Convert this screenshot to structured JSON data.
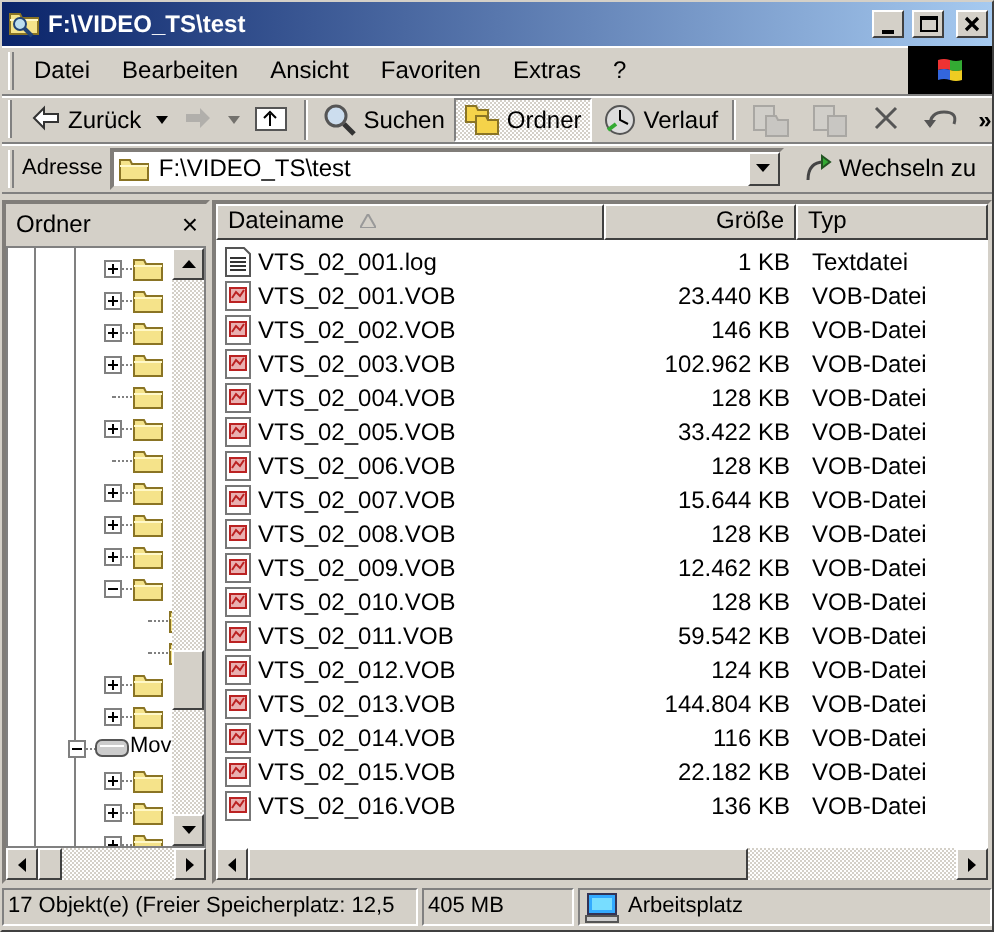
{
  "window": {
    "title": "F:\\VIDEO_TS\\test"
  },
  "menu": [
    {
      "label": "Datei"
    },
    {
      "label": "Bearbeiten"
    },
    {
      "label": "Ansicht"
    },
    {
      "label": "Favoriten"
    },
    {
      "label": "Extras"
    },
    {
      "label": "?"
    }
  ],
  "toolbar": {
    "buttons": [
      {
        "kind": "back",
        "label": "Zurück",
        "disabled": false
      },
      {
        "kind": "forward",
        "disabled": true
      },
      {
        "kind": "up",
        "disabled": false
      },
      {
        "kind": "search",
        "label": "Suchen",
        "selected": false
      },
      {
        "kind": "folders",
        "label": "Ordner",
        "selected": true
      },
      {
        "kind": "history",
        "label": "Verlauf",
        "selected": false
      },
      {
        "kind": "move",
        "disabled": true
      },
      {
        "kind": "copy",
        "disabled": true
      },
      {
        "kind": "delete",
        "disabled": false
      },
      {
        "kind": "undo",
        "disabled": false
      }
    ],
    "overflow": "»"
  },
  "address": {
    "label": "Adresse",
    "value": "F:\\VIDEO_TS\\test",
    "go": "Wechseln zu"
  },
  "tree": {
    "title": "Ordner",
    "close": "×",
    "items": [
      {
        "kind": "continuation",
        "children": [
          {
            "kind": "folder",
            "expanded": false
          },
          {
            "kind": "folder",
            "expanded": false
          },
          {
            "kind": "folder",
            "expanded": false
          },
          {
            "kind": "folder",
            "expanded": false
          },
          {
            "kind": "folder"
          },
          {
            "kind": "folder",
            "expanded": false
          },
          {
            "kind": "folder"
          },
          {
            "kind": "folder",
            "expanded": false
          },
          {
            "kind": "folder",
            "expanded": false
          },
          {
            "kind": "folder",
            "expanded": false
          },
          {
            "kind": "folder",
            "expanded": true,
            "children": [
              {
                "kind": "folder"
              },
              {
                "kind": "folder"
              }
            ]
          },
          {
            "kind": "folder",
            "expanded": false
          },
          {
            "kind": "folder",
            "expanded": false
          }
        ]
      },
      {
        "kind": "drive",
        "label": "Mov",
        "expanded": true,
        "children": [
          {
            "kind": "folder",
            "expanded": false
          },
          {
            "kind": "folder",
            "expanded": false
          },
          {
            "kind": "folder",
            "expanded": false
          }
        ]
      }
    ]
  },
  "files": {
    "columns": [
      {
        "label": "Dateiname",
        "sorted": true
      },
      {
        "label": "Größe"
      },
      {
        "label": "Typ"
      }
    ],
    "rows": [
      {
        "kind": "text",
        "name": "VTS_02_001.log",
        "size": "1 KB",
        "type": "Textdatei"
      },
      {
        "kind": "vob",
        "name": "VTS_02_001.VOB",
        "size": "23.440 KB",
        "type": "VOB-Datei"
      },
      {
        "kind": "vob",
        "name": "VTS_02_002.VOB",
        "size": "146 KB",
        "type": "VOB-Datei"
      },
      {
        "kind": "vob",
        "name": "VTS_02_003.VOB",
        "size": "102.962 KB",
        "type": "VOB-Datei"
      },
      {
        "kind": "vob",
        "name": "VTS_02_004.VOB",
        "size": "128 KB",
        "type": "VOB-Datei"
      },
      {
        "kind": "vob",
        "name": "VTS_02_005.VOB",
        "size": "33.422 KB",
        "type": "VOB-Datei"
      },
      {
        "kind": "vob",
        "name": "VTS_02_006.VOB",
        "size": "128 KB",
        "type": "VOB-Datei"
      },
      {
        "kind": "vob",
        "name": "VTS_02_007.VOB",
        "size": "15.644 KB",
        "type": "VOB-Datei"
      },
      {
        "kind": "vob",
        "name": "VTS_02_008.VOB",
        "size": "128 KB",
        "type": "VOB-Datei"
      },
      {
        "kind": "vob",
        "name": "VTS_02_009.VOB",
        "size": "12.462 KB",
        "type": "VOB-Datei"
      },
      {
        "kind": "vob",
        "name": "VTS_02_010.VOB",
        "size": "128 KB",
        "type": "VOB-Datei"
      },
      {
        "kind": "vob",
        "name": "VTS_02_011.VOB",
        "size": "59.542 KB",
        "type": "VOB-Datei"
      },
      {
        "kind": "vob",
        "name": "VTS_02_012.VOB",
        "size": "124 KB",
        "type": "VOB-Datei"
      },
      {
        "kind": "vob",
        "name": "VTS_02_013.VOB",
        "size": "144.804 KB",
        "type": "VOB-Datei"
      },
      {
        "kind": "vob",
        "name": "VTS_02_014.VOB",
        "size": "116 KB",
        "type": "VOB-Datei"
      },
      {
        "kind": "vob",
        "name": "VTS_02_015.VOB",
        "size": "22.182 KB",
        "type": "VOB-Datei"
      },
      {
        "kind": "vob",
        "name": "VTS_02_016.VOB",
        "size": "136 KB",
        "type": "VOB-Datei"
      }
    ]
  },
  "status_bar": [
    {
      "kind": "plain",
      "text": "17 Objekt(e) (Freier Speicherplatz: 12,5"
    },
    {
      "kind": "plain",
      "text": "405 MB"
    },
    {
      "kind": "computer",
      "text": "Arbeitsplatz"
    }
  ]
}
